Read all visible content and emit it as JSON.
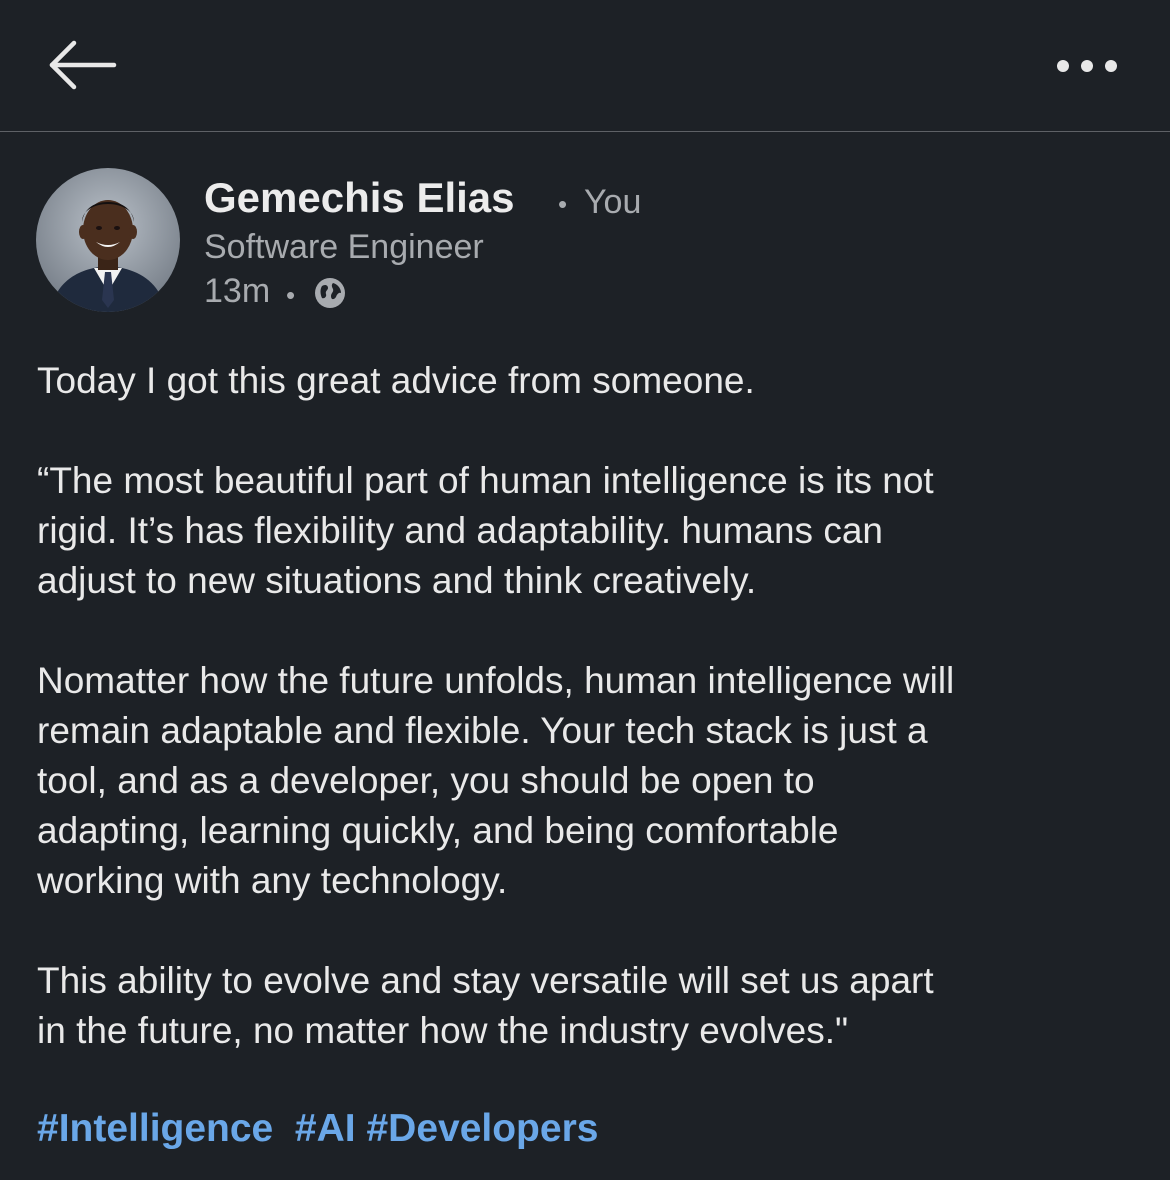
{
  "header": {
    "back_icon": "arrow-left-icon",
    "more_icon": "ellipsis-horizontal-icon"
  },
  "author": {
    "name": "Gemechis Elias",
    "relation": "You",
    "headline": "Software Engineer",
    "time": "13m",
    "visibility_icon": "globe-icon"
  },
  "post": {
    "paragraphs": [
      [
        "Today I got this great advice from someone."
      ],
      [
        "“The most beautiful part of human intelligence is its not",
        "rigid. It’s has flexibility and adaptability. humans can",
        "adjust to new situations and think creatively."
      ],
      [
        "Nomatter how the future unfolds, human intelligence will",
        "remain adaptable and flexible. Your tech stack is just a",
        "tool, and as a developer, you should be open to",
        "adapting, learning quickly, and being comfortable",
        "working with any technology."
      ],
      [
        "This ability to evolve and stay versatile will set us apart",
        "in the future, no matter how the industry evolves.\""
      ]
    ],
    "hashtags": [
      "#Intelligence",
      "#AI",
      "#Developers"
    ]
  },
  "colors": {
    "background": "#1d2126",
    "text": "#e9e9e9",
    "muted": "#a8abaf",
    "link": "#6aa7e8"
  }
}
